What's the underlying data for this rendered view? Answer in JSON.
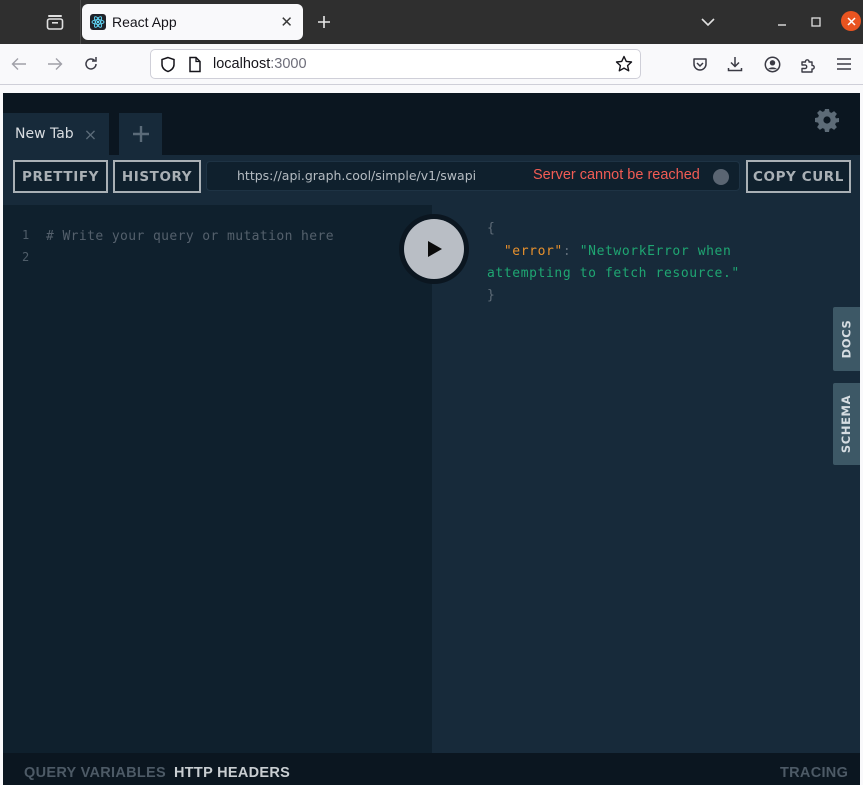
{
  "browser": {
    "tab_title": "React App",
    "url_host": "localhost",
    "url_port": ":3000",
    "icons": [
      "tab-overview-icon",
      "react-favicon",
      "close-icon",
      "new-tab-icon",
      "list-all-tabs-icon",
      "minimize-icon",
      "maximize-icon",
      "window-close-icon",
      "back-icon",
      "forward-icon",
      "reload-icon",
      "shield-icon",
      "page-icon",
      "bookmark-star-icon",
      "pocket-icon",
      "download-icon",
      "account-icon",
      "extensions-icon",
      "menu-icon"
    ]
  },
  "app": {
    "tabs": [
      {
        "label": "New Tab",
        "close": "×"
      }
    ],
    "new_tab": "+",
    "toolbar": {
      "prettify_label": "PRETTIFY",
      "history_label": "HISTORY",
      "copy_curl_label": "COPY CURL",
      "endpoint_url": "https://api.graph.cool/simple/v1/swapi",
      "endpoint_status": "Server cannot be reached"
    },
    "editor": {
      "lines": [
        {
          "num": "1",
          "text": "# Write your query or mutation here"
        },
        {
          "num": "2",
          "text": ""
        }
      ]
    },
    "result": {
      "open_brace": "{",
      "key": "\"error\"",
      "colon": ": ",
      "value_part1": "\"NetworkError when",
      "value_part2": "attempting to fetch resource.\"",
      "close_brace": "}"
    },
    "side_tabs": {
      "docs": "DOCS",
      "schema": "SCHEMA"
    },
    "bottom": {
      "query_variables": "QUERY VARIABLES",
      "http_headers": "HTTP HEADERS",
      "tracing": "TRACING"
    },
    "colors": {
      "status_error": "#f25c54",
      "json_key": "#e8912d",
      "json_string": "#1fa672",
      "window_close": "#e95420"
    }
  }
}
